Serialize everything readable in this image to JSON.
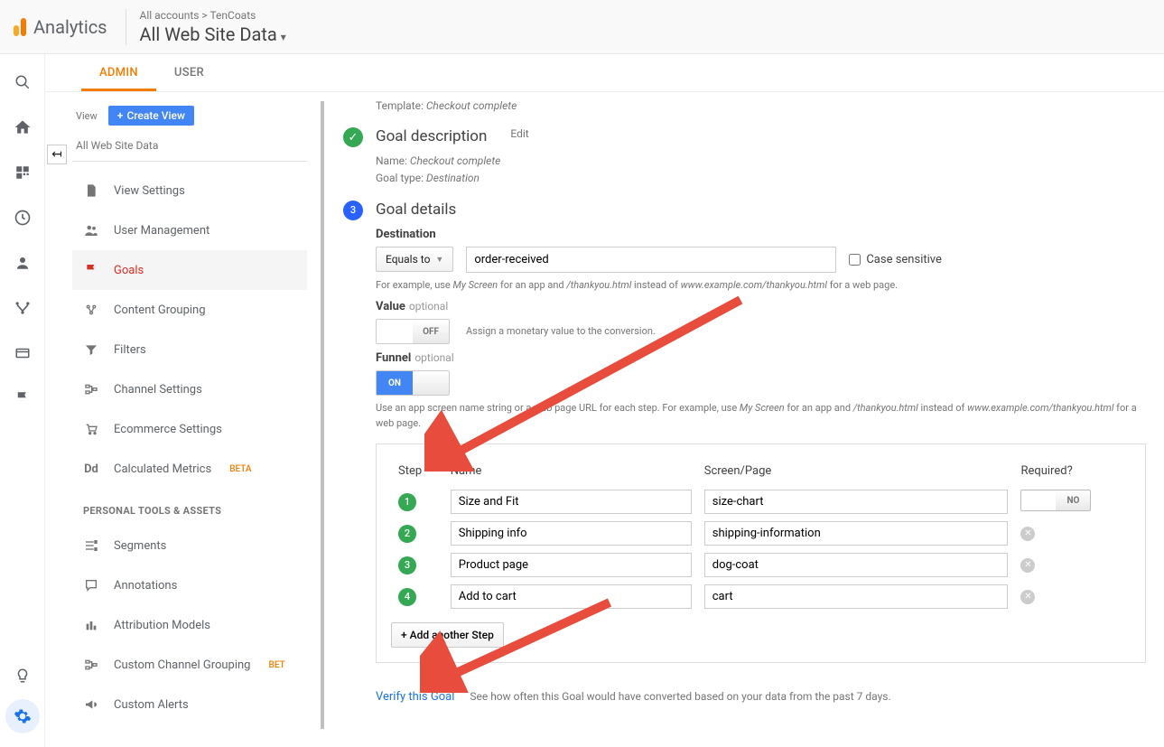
{
  "header": {
    "logo_text": "Analytics",
    "breadcrumb_all": "All accounts",
    "breadcrumb_account": "TenCoats",
    "data_view": "All Web Site Data"
  },
  "tabs": {
    "admin": "ADMIN",
    "user": "USER"
  },
  "sidebar": {
    "view_label": "View",
    "create_view": "Create View",
    "view_name": "All Web Site Data",
    "items": [
      "View Settings",
      "User Management",
      "Goals",
      "Content Grouping",
      "Filters",
      "Channel Settings",
      "Ecommerce Settings",
      "Calculated Metrics"
    ],
    "beta": "BETA",
    "section": "PERSONAL TOOLS & ASSETS",
    "personal": [
      "Segments",
      "Annotations",
      "Attribution Models",
      "Custom Channel Grouping",
      "Custom Alerts"
    ],
    "bet": "BET"
  },
  "goal": {
    "setup_template_label": "Template:",
    "setup_template_val": "Checkout complete",
    "desc_title": "Goal description",
    "edit": "Edit",
    "desc_name_label": "Name:",
    "desc_name_val": "Checkout complete",
    "desc_type_label": "Goal type:",
    "desc_type_val": "Destination",
    "details_title": "Goal details",
    "dest_label": "Destination",
    "dest_match": "Equals to",
    "dest_value": "order-received",
    "case_sensitive": "Case sensitive",
    "dest_help_pre": "For example, use ",
    "dest_help_em1": "My Screen",
    "dest_help_mid1": " for an app and ",
    "dest_help_em2": "/thankyou.html",
    "dest_help_mid2": " instead of ",
    "dest_help_em3": "www.example.com/thankyou.html",
    "dest_help_post": " for a web page.",
    "value_label": "Value",
    "optional": "optional",
    "off": "OFF",
    "on": "ON",
    "value_help": "Assign a monetary value to the conversion.",
    "funnel_label": "Funnel",
    "funnel_help_1": "Use an app screen name string or a web page URL for each step. For example, use ",
    "funnel_help_em1": "My Screen",
    "funnel_help_2": " for an app and ",
    "funnel_help_em2": "/thankyou.html",
    "funnel_help_3": " instead of ",
    "funnel_help_em3": "www.example.com/thankyou.html",
    "funnel_help_4": " for a web page.",
    "th_step": "Step",
    "th_name": "Name",
    "th_page": "Screen/Page",
    "th_req": "Required?",
    "no": "NO",
    "steps": [
      {
        "n": "1",
        "name": "Size and Fit",
        "page": "size-chart"
      },
      {
        "n": "2",
        "name": "Shipping info",
        "page": "shipping-information"
      },
      {
        "n": "3",
        "name": "Product page",
        "page": "dog-coat"
      },
      {
        "n": "4",
        "name": "Add to cart",
        "page": "cart"
      }
    ],
    "add_step": "+ Add another Step",
    "verify": "Verify this Goal",
    "verify_help": "See how often this Goal would have converted based on your data from the past 7 days."
  }
}
